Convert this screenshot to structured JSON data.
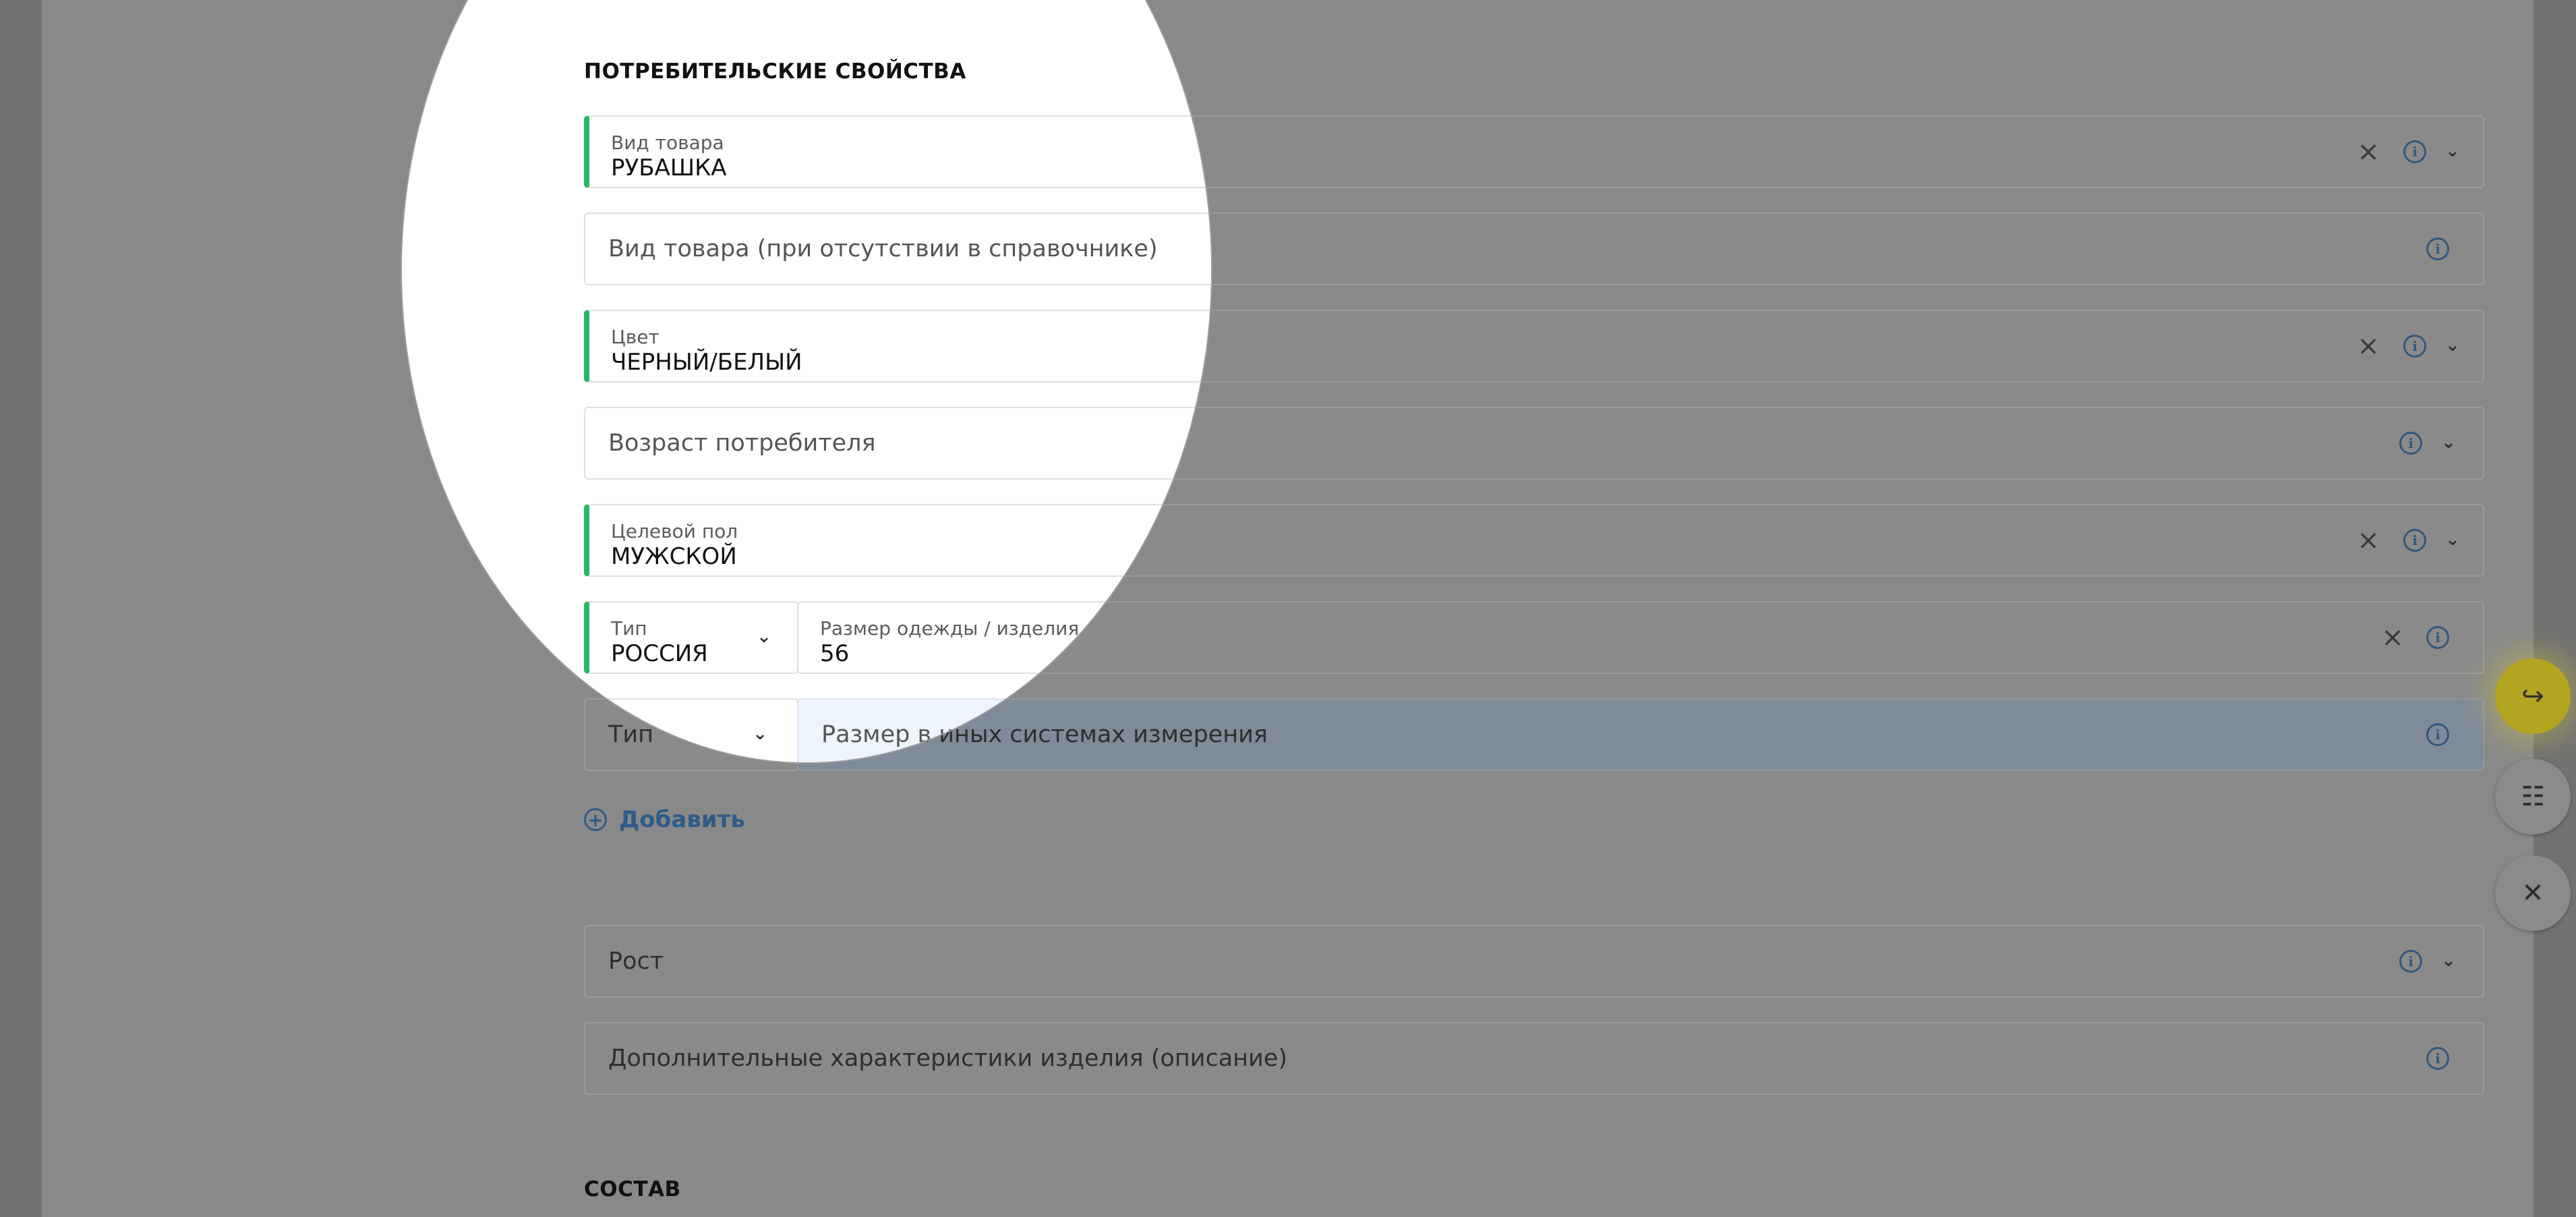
{
  "section_consumer": "ПОТРЕБИТЕЛЬСКИЕ СВОЙСТВА",
  "fields": {
    "product_type": {
      "label": "Вид товара",
      "value": "РУБАШКА"
    },
    "product_type_other": {
      "placeholder": "Вид товара (при отсутствии в справочнике)"
    },
    "color": {
      "label": "Цвет",
      "value": "ЧЕРНЫЙ/БЕЛЫЙ"
    },
    "consumer_age": {
      "placeholder": "Возраст потребителя"
    },
    "target_gender": {
      "label": "Целевой пол",
      "value": "МУЖСКОЙ"
    },
    "size_type_1": {
      "label": "Тип",
      "value": "РОССИЯ"
    },
    "size_1": {
      "label": "Размер одежды / изделия",
      "value": "56"
    },
    "size_type_2": {
      "placeholder": "Тип"
    },
    "size_other": {
      "placeholder": "Размер в иных системах измерения"
    },
    "height": {
      "placeholder": "Рост"
    },
    "extra": {
      "placeholder": "Дополнительные характеристики изделия (описание)"
    }
  },
  "add_label": "Добавить",
  "section_composition": "СОСТАВ",
  "icons": {
    "info": "info-icon",
    "clear": "close-icon",
    "chevron": "chevron-down-icon",
    "fab_primary": "export-icon",
    "fab_doc": "document-edit-icon",
    "fab_close": "close-icon"
  },
  "colors": {
    "accent_green": "#22b865",
    "link_blue": "#2f5b88",
    "fab_yellow": "#e0cf28"
  }
}
